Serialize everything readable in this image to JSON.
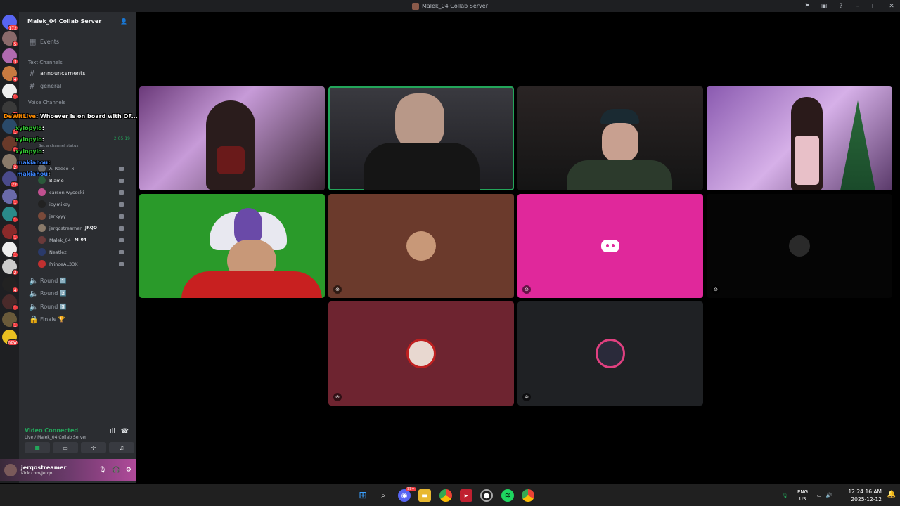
{
  "window": {
    "title": "Malek_04 Collab Server"
  },
  "server": {
    "name": "Malek_04 Collab Server",
    "events_label": "Events",
    "text_category": "Text Channels",
    "text_channels": [
      "announcements",
      "general"
    ],
    "voice_category": "Voice Channels",
    "voice_channels_below": [
      "Round 1️⃣",
      "Round 2️⃣",
      "Round 3️⃣",
      "Finale 🏆"
    ],
    "call_timer": "2:05:19",
    "custom_status_hint": "Set a channel status"
  },
  "voice_users": [
    {
      "name": "A_ReeceTx",
      "tag": ""
    },
    {
      "name": "Blame",
      "tag": ""
    },
    {
      "name": "carson wysocki",
      "tag": ""
    },
    {
      "name": "icy.mikey",
      "tag": ""
    },
    {
      "name": "jerkyyy",
      "tag": ""
    },
    {
      "name": "jerqostreamer",
      "tag": "JRQO"
    },
    {
      "name": "Malek_04",
      "tag": "M_04"
    },
    {
      "name": "Neatlez",
      "tag": ""
    },
    {
      "name": "PrinceAL33X",
      "tag": ""
    }
  ],
  "chat_overlay": [
    {
      "user": "DeWitLive",
      "text": ": Whoever is on board with OF... YOURE A CUCK",
      "color": "#ff8c00"
    },
    {
      "user": "xylopylo",
      "text": ":",
      "color": "#33cc33"
    },
    {
      "user": "xylopylo",
      "text": ":",
      "color": "#33cc33"
    },
    {
      "user": "xylopylo",
      "text": ":",
      "color": "#33cc33"
    },
    {
      "user": "makiahou",
      "text": ":",
      "color": "#3b82f6"
    },
    {
      "user": "makiahou",
      "text": ":",
      "color": "#3b82f6"
    }
  ],
  "rail_badges": [
    "172",
    "5",
    "3",
    "4",
    "1",
    "1",
    "1",
    "1",
    "2",
    "22",
    "1",
    "1",
    "1",
    "1",
    "2",
    "4",
    "1",
    "1",
    "NEW"
  ],
  "connection": {
    "title": "Video Connected",
    "subtitle": "Live / Malek_04 Collab Server"
  },
  "user_panel": {
    "name": "jerqostreamer",
    "status": "Kick.com/Jerqo"
  },
  "taskbar": {
    "lang_top": "ENG",
    "lang_bottom": "US",
    "time": "12:24:16 AM",
    "date": "2025-12-12",
    "discord_badge": "99+"
  },
  "colors": {
    "speaking": "#23a55a",
    "discord_pink": "#e0289b",
    "tile_brown": "#6b3a2c",
    "tile_maroon": "#6e2430",
    "tile_dark": "#1f2124"
  }
}
